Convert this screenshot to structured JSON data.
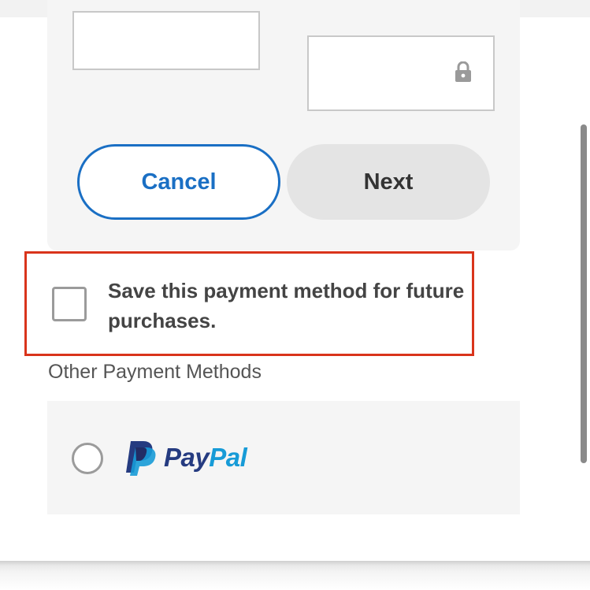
{
  "card_form": {
    "field_a_value": "",
    "field_b_value": "",
    "lock_icon": "lock-icon"
  },
  "buttons": {
    "cancel_label": "Cancel",
    "next_label": "Next"
  },
  "save_option": {
    "label": "Save this payment method for future purchases.",
    "checked": false,
    "highlight_color": "#d9341b"
  },
  "other_methods": {
    "title": "Other Payment Methods",
    "options": [
      {
        "brand_pay": "Pay",
        "brand_pal": "Pal",
        "selected": false,
        "logo_icon": "paypal-icon"
      }
    ]
  },
  "colors": {
    "accent": "#1a6fc4",
    "paypal_dark": "#253b80",
    "paypal_light": "#179bd7"
  }
}
